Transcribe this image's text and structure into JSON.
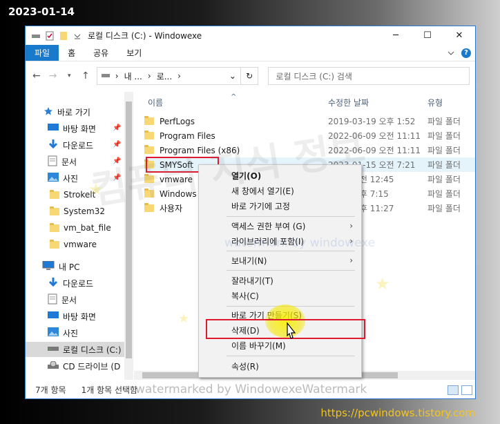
{
  "date_stamp": "2023-01-14",
  "blog_url": "https://pcwindows.tistory.com",
  "window": {
    "title": "로컬 디스크 (C:) - Windowexe",
    "controls": {
      "minimize": "─",
      "maximize": "☐",
      "close": "✕"
    }
  },
  "ribbon": {
    "tabs": [
      "파일",
      "홈",
      "공유",
      "보기"
    ],
    "expand_icon": "chevron-down-icon",
    "help": "?"
  },
  "address": {
    "crumbs": [
      "내 ...",
      "로..."
    ],
    "search_placeholder": "로컬 디스크 (C:) 검색"
  },
  "sidebar": {
    "items": [
      {
        "label": "바로 가기",
        "icon": "star-icon",
        "pinned": false
      },
      {
        "label": "바탕 화면",
        "icon": "desktop-icon",
        "pinned": true
      },
      {
        "label": "다운로드",
        "icon": "download-icon",
        "pinned": true
      },
      {
        "label": "문서",
        "icon": "document-icon",
        "pinned": true
      },
      {
        "label": "사진",
        "icon": "pictures-icon",
        "pinned": true
      },
      {
        "label": "Strokelt",
        "icon": "folder-icon",
        "pinned": false
      },
      {
        "label": "System32",
        "icon": "folder-icon",
        "pinned": false
      },
      {
        "label": "vm_bat_file",
        "icon": "folder-icon",
        "pinned": false
      },
      {
        "label": "vmware",
        "icon": "folder-icon",
        "pinned": false
      },
      {
        "label": "내 PC",
        "icon": "pc-icon",
        "pinned": false
      },
      {
        "label": "다운로드",
        "icon": "download-icon",
        "pinned": false
      },
      {
        "label": "문서",
        "icon": "document-icon",
        "pinned": false
      },
      {
        "label": "바탕 화면",
        "icon": "desktop-icon",
        "pinned": false
      },
      {
        "label": "사진",
        "icon": "pictures-icon",
        "pinned": false
      },
      {
        "label": "로컬 디스크 (C:)",
        "icon": "drive-icon",
        "pinned": false,
        "selected": true
      },
      {
        "label": "CD 드라이브 (D",
        "icon": "cd-drive-icon",
        "pinned": false
      }
    ]
  },
  "columns": {
    "name": "이름",
    "modified": "수정한 날짜",
    "type": "유형"
  },
  "files": [
    {
      "name": "PerfLogs",
      "date": "2019-03-19 오후 1:52",
      "type": "파일 폴더"
    },
    {
      "name": "Program Files",
      "date": "2022-06-09 오전 11:11",
      "type": "파일 폴더"
    },
    {
      "name": "Program Files (x86)",
      "date": "2022-06-09 오전 11:11",
      "type": "파일 폴더"
    },
    {
      "name": "SMYSoft",
      "date": "2023-01-15 오전 7:21",
      "type": "파일 폴더",
      "selected": true
    },
    {
      "name": "vmware",
      "date": "...-15 오전 12:45",
      "type": "파일 폴더"
    },
    {
      "name": "Windows",
      "date": "...-10 오후 7:15",
      "type": "파일 폴더"
    },
    {
      "name": "사용자",
      "date": "...-08 오후 11:27",
      "type": "파일 폴더"
    }
  ],
  "status": {
    "count": "7개 항목",
    "selected": "1개 항목 선택함"
  },
  "context_menu": {
    "groups": [
      [
        {
          "label": "열기(O)",
          "bold": true
        },
        {
          "label": "새 창에서 열기(E)"
        },
        {
          "label": "바로 가기에 고정"
        }
      ],
      [
        {
          "label": "액세스 권한 부여 (G)",
          "submenu": true
        },
        {
          "label": "라이브러리에 포함(I)",
          "submenu": true
        }
      ],
      [
        {
          "label": "보내기(N)",
          "submenu": true
        }
      ],
      [
        {
          "label": "잘라내기(T)"
        },
        {
          "label": "복사(C)"
        }
      ],
      [
        {
          "label": "바로 가기 만들기(S)"
        },
        {
          "label": "삭제(D)",
          "highlighted": true
        },
        {
          "label": "이름 바꾸기(M)"
        }
      ],
      [
        {
          "label": "속성(R)"
        }
      ]
    ]
  },
  "watermarks": {
    "korean": "컴퓨터 지식 정보",
    "blue": "watermark by windowexe",
    "bottom": "watermarked by WindowexeWatermark"
  },
  "colors": {
    "accent": "#1979ca",
    "selection": "#e5f3fb",
    "annotation": "#e0182d",
    "pointer_highlight": "#f5e600"
  }
}
